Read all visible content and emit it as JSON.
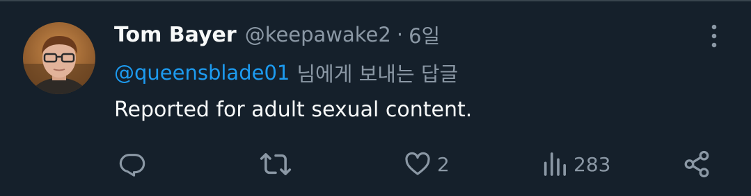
{
  "tweet": {
    "author": {
      "display_name": "Tom Bayer",
      "handle": "@keepawake2",
      "separator": "·",
      "time": "6일"
    },
    "reply_to": {
      "mention": "@queensblade01",
      "suffix": "님에게 보내는 답글"
    },
    "text": "Reported for adult sexual content.",
    "actions": {
      "reply": {
        "icon": "reply-icon"
      },
      "retweet": {
        "icon": "retweet-icon"
      },
      "like": {
        "icon": "heart-icon",
        "count": "2"
      },
      "views": {
        "icon": "views-icon",
        "count": "283"
      },
      "share": {
        "icon": "share-icon"
      }
    },
    "more_icon": "more-vertical-icon"
  },
  "colors": {
    "background": "#15202b",
    "primary_text": "#f7f9f9",
    "secondary_text": "#8b98a5",
    "link": "#1d9bf0",
    "divider": "#38444d"
  }
}
